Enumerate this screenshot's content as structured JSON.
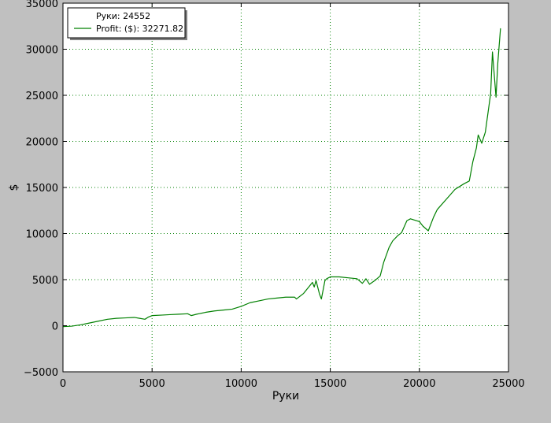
{
  "colors": {
    "figure_background": "#c0c0c0",
    "plot_background": "#ffffff",
    "grid": "#008000",
    "line": "#008000",
    "axis": "#000000"
  },
  "legend": {
    "placement": "top-left",
    "entries": [
      {
        "label": "Руки: 24552",
        "has_line": false
      },
      {
        "label": "Profit: ($): 32271.82",
        "has_line": true,
        "color": "#008000"
      }
    ]
  },
  "chart_data": {
    "type": "line",
    "title": "",
    "xlabel": "Руки",
    "ylabel": "$",
    "xlim": [
      0,
      25000
    ],
    "ylim": [
      -5000,
      35000
    ],
    "xticks": [
      0,
      5000,
      10000,
      15000,
      20000,
      25000
    ],
    "yticks": [
      -5000,
      0,
      5000,
      10000,
      15000,
      20000,
      25000,
      30000,
      35000
    ],
    "xtick_labels": [
      "0",
      "5000",
      "10000",
      "15000",
      "20000",
      "25000"
    ],
    "ytick_labels": [
      "−5000",
      "0",
      "5000",
      "10000",
      "15000",
      "20000",
      "25000",
      "30000",
      "35000"
    ],
    "grid": true,
    "grid_style": "dotted",
    "series": [
      {
        "name": "Profit: ($): 32271.82",
        "color": "#008000",
        "x": [
          0,
          500,
          1000,
          1500,
          2000,
          2500,
          3000,
          3500,
          4000,
          4300,
          4600,
          4800,
          5000,
          5500,
          6000,
          6500,
          7000,
          7200,
          7500,
          8000,
          8500,
          9000,
          9500,
          10000,
          10500,
          11000,
          11500,
          12000,
          12500,
          13000,
          13100,
          13500,
          14000,
          14100,
          14200,
          14400,
          14500,
          14600,
          14700,
          14800,
          15000,
          15500,
          16000,
          16500,
          16800,
          17000,
          17200,
          17500,
          17800,
          18000,
          18300,
          18500,
          18800,
          19000,
          19300,
          19500,
          20000,
          20200,
          20500,
          20800,
          21000,
          21500,
          22000,
          22500,
          22800,
          23000,
          23200,
          23300,
          23500,
          23700,
          23800,
          24000,
          24100,
          24300,
          24400,
          24552
        ],
        "y": [
          -100,
          -50,
          100,
          300,
          500,
          700,
          800,
          850,
          900,
          800,
          700,
          950,
          1100,
          1150,
          1200,
          1250,
          1300,
          1100,
          1250,
          1450,
          1600,
          1700,
          1800,
          2100,
          2500,
          2700,
          2900,
          3000,
          3100,
          3100,
          2900,
          3500,
          4700,
          4200,
          4900,
          3400,
          2900,
          3900,
          4900,
          5100,
          5300,
          5300,
          5200,
          5100,
          4600,
          5100,
          4500,
          4900,
          5400,
          6900,
          8500,
          9200,
          9800,
          10100,
          11400,
          11600,
          11300,
          10800,
          10300,
          11800,
          12600,
          13700,
          14800,
          15400,
          15700,
          17800,
          19300,
          20700,
          19800,
          21000,
          22400,
          25200,
          29700,
          24800,
          28500,
          32271.82
        ]
      }
    ]
  }
}
